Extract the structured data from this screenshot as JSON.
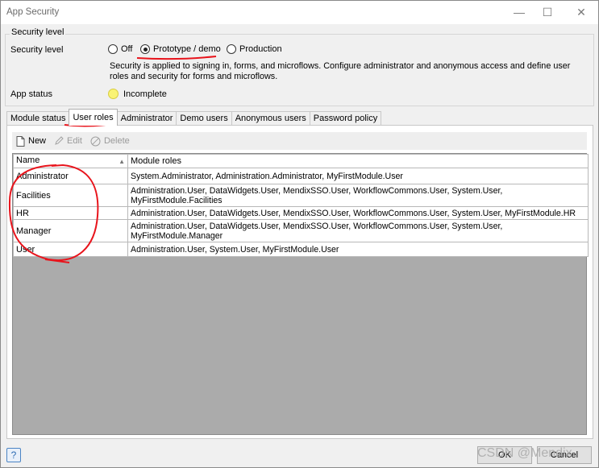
{
  "window": {
    "title": "App Security",
    "minimize_glyph": "—",
    "maximize_glyph": "☐",
    "close_glyph": "✕"
  },
  "security_level": {
    "group_title": "Security level",
    "label": "Security level",
    "options": [
      "Off",
      "Prototype / demo",
      "Production"
    ],
    "selected": "Prototype / demo",
    "description": "Security is applied to signing in, forms, and microflows. Configure administrator and anonymous access and define user roles and security for forms and microflows."
  },
  "app_status": {
    "label": "App status",
    "value": "Incomplete",
    "color": "#f9f374"
  },
  "tabs": [
    "Module status",
    "User roles",
    "Administrator",
    "Demo users",
    "Anonymous users",
    "Password policy"
  ],
  "active_tab": "User roles",
  "toolbar": {
    "new_label": "New",
    "edit_label": "Edit",
    "delete_label": "Delete"
  },
  "table": {
    "columns": [
      "Name",
      "Module roles"
    ],
    "rows": [
      {
        "name": "Administrator",
        "roles": "System.Administrator, Administration.Administrator, MyFirstModule.User"
      },
      {
        "name": "Facilities",
        "roles": "Administration.User, DataWidgets.User, MendixSSO.User, WorkflowCommons.User, System.User, MyFirstModule.Facilities"
      },
      {
        "name": "HR",
        "roles": "Administration.User, DataWidgets.User, MendixSSO.User, WorkflowCommons.User, System.User, MyFirstModule.HR"
      },
      {
        "name": "Manager",
        "roles": "Administration.User, DataWidgets.User, MendixSSO.User, WorkflowCommons.User, System.User, MyFirstModule.Manager"
      },
      {
        "name": "User",
        "roles": "Administration.User, System.User, MyFirstModule.User"
      }
    ]
  },
  "buttons": {
    "help": "?",
    "ok": "OK",
    "cancel": "Cancel"
  },
  "watermark": "CSDN @Mendix",
  "annotation_color": "#e8141c"
}
